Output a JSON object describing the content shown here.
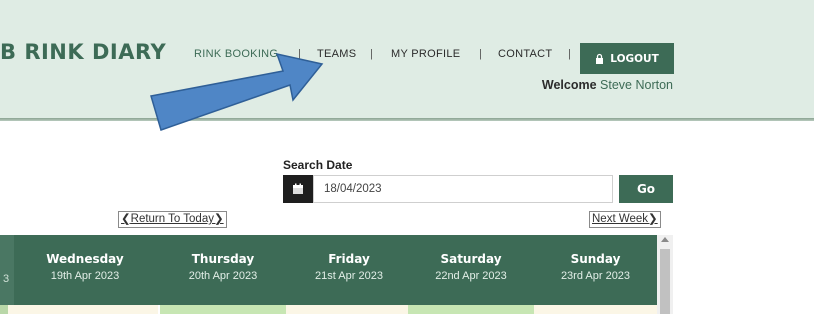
{
  "header": {
    "brand": "B RINK DIARY",
    "nav": [
      {
        "label": "RINK BOOKING"
      },
      {
        "label": "TEAMS"
      },
      {
        "label": "MY PROFILE"
      },
      {
        "label": "CONTACT"
      }
    ],
    "separator": "|",
    "logout_label": "LOGOUT",
    "welcome_label": "Welcome",
    "welcome_user": "Steve Norton"
  },
  "search": {
    "label": "Search Date",
    "value": "18/04/2023",
    "go_label": "Go"
  },
  "navigation": {
    "return_today": "Return To Today",
    "next_week": "Next Week"
  },
  "days": [
    {
      "name": "Wednesday",
      "date": "19th Apr 2023"
    },
    {
      "name": "Thursday",
      "date": "20th Apr 2023"
    },
    {
      "name": "Friday",
      "date": "21st Apr 2023"
    },
    {
      "name": "Saturday",
      "date": "22nd Apr 2023"
    },
    {
      "name": "Sunday",
      "date": "23rd Apr 2023"
    }
  ],
  "partial_col_text": "3",
  "colors": {
    "accent": "#3d6b56",
    "header_bg": "#dfece4",
    "annotation_arrow": "#4f86c6"
  },
  "icons": {
    "lock": "lock-icon",
    "calendar": "calendar-icon",
    "annotation": "arrow-annotation-icon"
  }
}
